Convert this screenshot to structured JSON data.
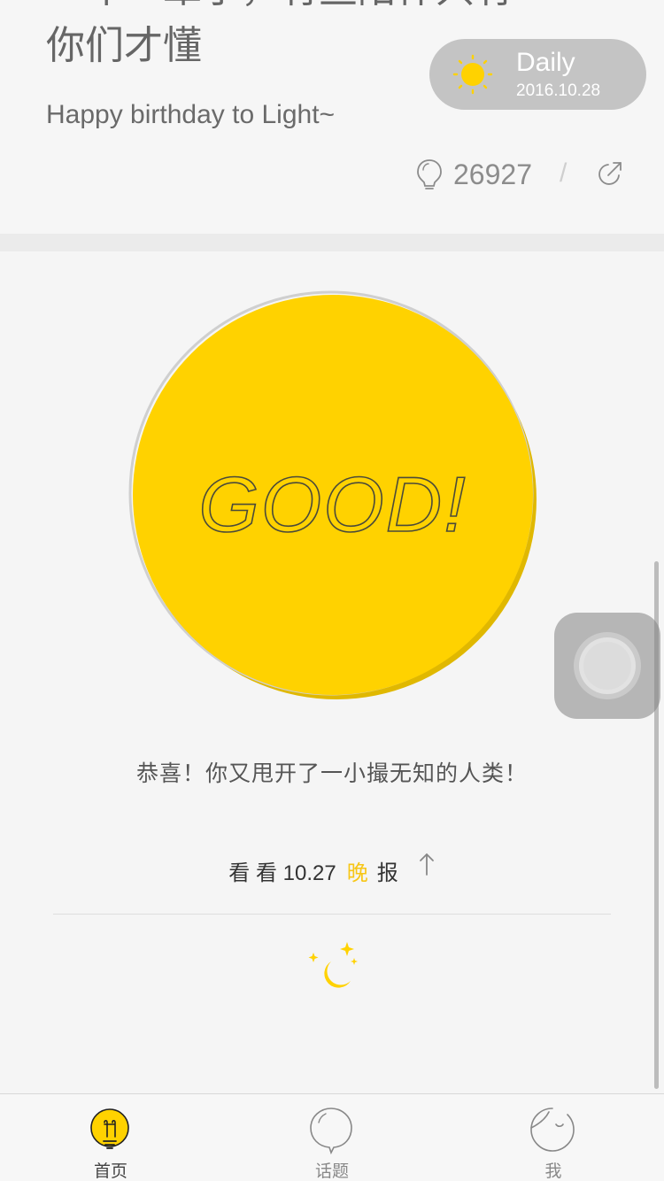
{
  "article": {
    "title_line1": "一年一辈子，有些陪伴只有",
    "title_line2": "你们才懂",
    "subtitle": "Happy birthday to Light~",
    "like_count": "26927",
    "divider": "/"
  },
  "daily_badge": {
    "label": "Daily",
    "date": "2016.10.28"
  },
  "result": {
    "badge_text": "GOOD!",
    "message": "恭喜！你又甩开了一小撮无知的人类！"
  },
  "evening_report": {
    "prefix": "看 看 10.27",
    "highlight": "晚",
    "suffix": "报"
  },
  "tabbar": {
    "items": [
      {
        "label": "首页",
        "icon": "bulb-icon",
        "active": true
      },
      {
        "label": "话题",
        "icon": "speech-bubble-icon",
        "active": false
      },
      {
        "label": "我",
        "icon": "face-icon",
        "active": false
      }
    ]
  },
  "colors": {
    "accent_yellow": "#ffd200",
    "badge_gray": "#c4c4c4",
    "background": "#f5f5f5",
    "text_gray": "#666666"
  }
}
